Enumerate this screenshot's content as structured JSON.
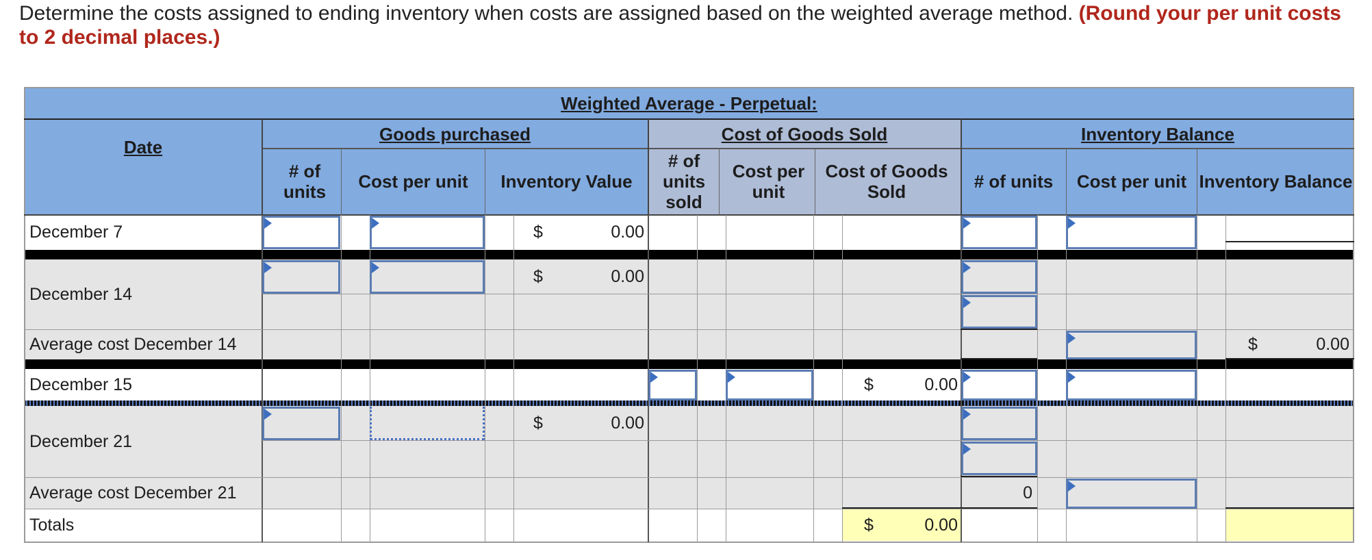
{
  "instruction": {
    "text": "Determine the costs assigned to ending inventory when costs are assigned based on the weighted average method.",
    "emphasis": "(Round your per unit costs to 2 decimal places.)"
  },
  "table": {
    "title": "Weighted Average - Perpetual:",
    "group_headers": {
      "goods_purchased": "Goods purchased",
      "cost_of_goods_sold": "Cost of Goods Sold",
      "inventory_balance": "Inventory Balance"
    },
    "column_headers": {
      "date": "Date",
      "gp_units": "# of units",
      "gp_cost_per_unit": "Cost per unit",
      "gp_inventory_value": "Inventory Value",
      "cogs_units_sold": "# of units sold",
      "cogs_cost_per_unit": "Cost per unit",
      "cogs_cost_of_goods_sold": "Cost of Goods Sold",
      "ib_units": "# of units",
      "ib_cost_per_unit": "Cost per unit",
      "ib_inventory_balance": "Inventory Balance"
    },
    "rows": {
      "dec7": "December 7",
      "dec14": "December 14",
      "avg14": "Average cost December 14",
      "dec15": "December 15",
      "dec21": "December 21",
      "avg21": "Average cost December 21",
      "totals": "Totals"
    },
    "currency_symbol": "$",
    "values": {
      "dec7_inventory_value": "0.00",
      "dec14_inventory_value": "0.00",
      "avg14_inventory_balance": "0.00",
      "dec15_cost_of_goods_sold": "0.00",
      "dec21_inventory_value": "0.00",
      "avg21_units": "0",
      "totals_cost_of_goods_sold": "0.00"
    }
  },
  "colors": {
    "header_blue": "#82abe0",
    "cogs_header": "#aebcd6",
    "row_gray": "#e5e5e5",
    "highlight_yellow": "#ffffb8",
    "input_border": "#5a7cb2",
    "instruction_red": "#b0271c"
  }
}
